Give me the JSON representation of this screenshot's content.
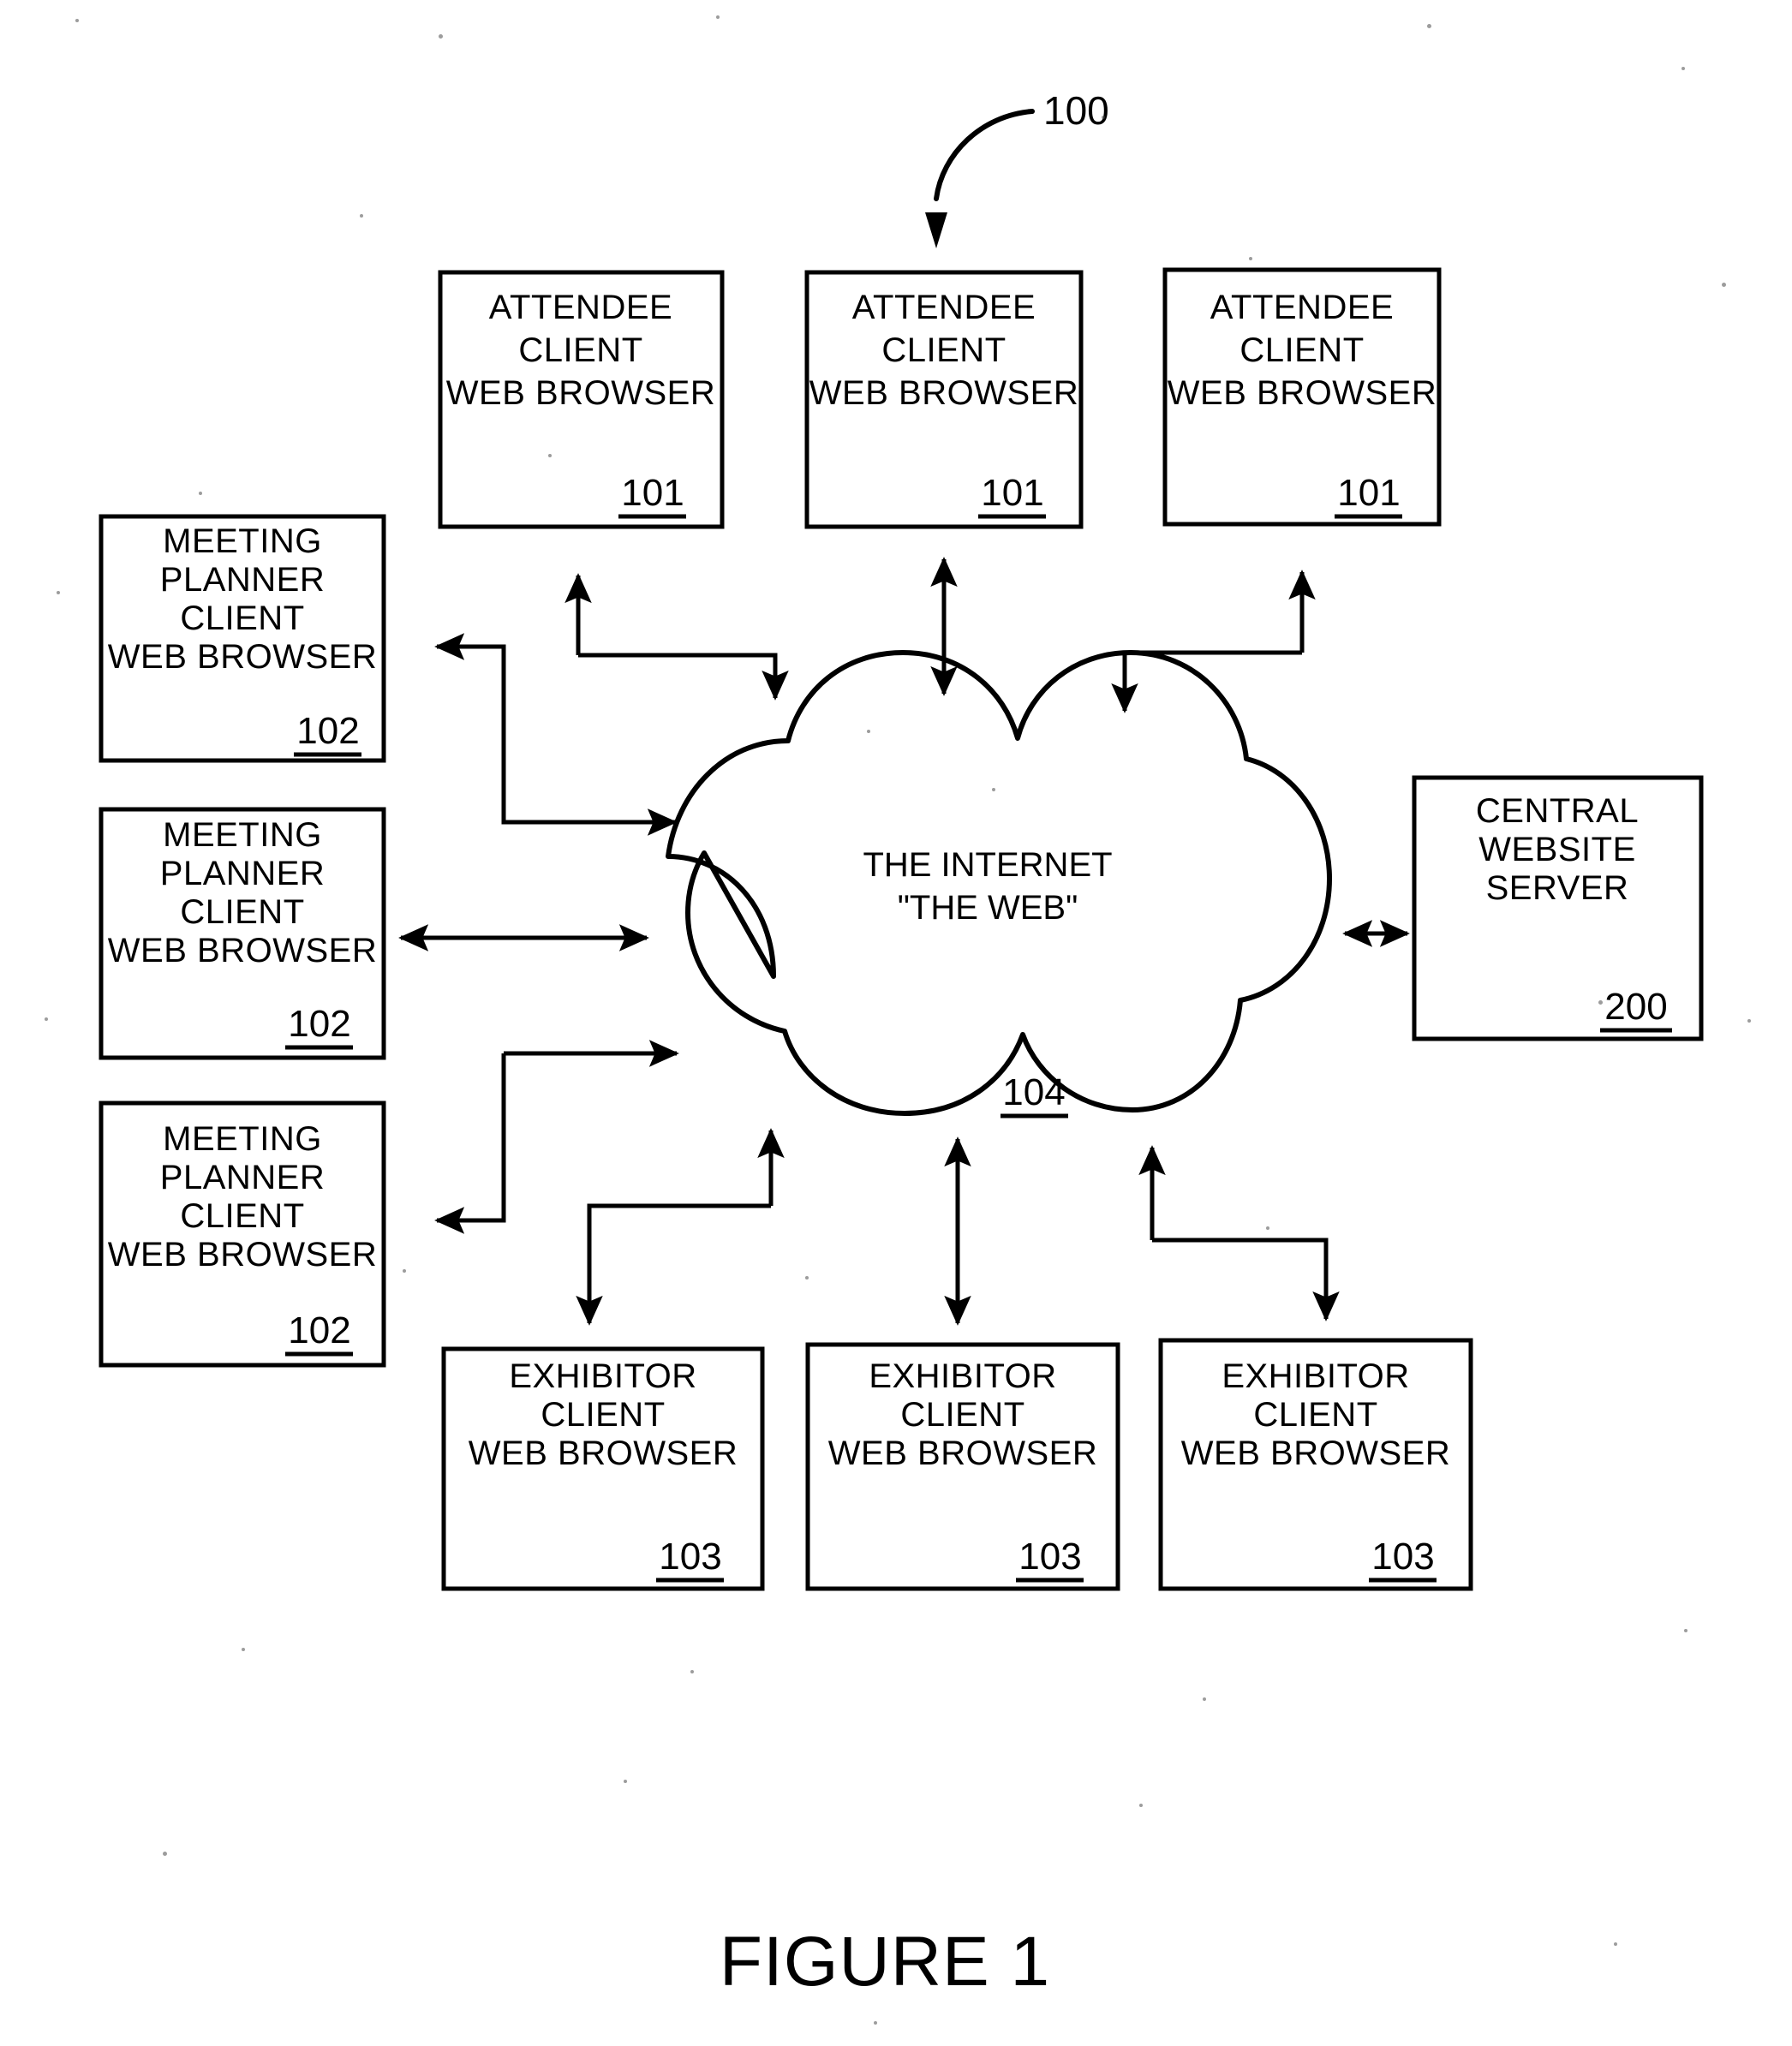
{
  "figure": {
    "caption": "FIGURE 1",
    "system_callout": "100"
  },
  "cloud": {
    "line1": "THE INTERNET",
    "line2": "\"THE WEB\"",
    "ref": "104"
  },
  "attendee_clients": [
    {
      "line1": "ATTENDEE",
      "line2": "CLIENT",
      "line3": "WEB BROWSER",
      "ref": "101"
    },
    {
      "line1": "ATTENDEE",
      "line2": "CLIENT",
      "line3": "WEB BROWSER",
      "ref": "101"
    },
    {
      "line1": "ATTENDEE",
      "line2": "CLIENT",
      "line3": "WEB BROWSER",
      "ref": "101"
    }
  ],
  "meeting_planner_clients": [
    {
      "line1": "MEETING",
      "line2": "PLANNER",
      "line3": "CLIENT",
      "line4": "WEB BROWSER",
      "ref": "102"
    },
    {
      "line1": "MEETING",
      "line2": "PLANNER",
      "line3": "CLIENT",
      "line4": "WEB BROWSER",
      "ref": "102"
    },
    {
      "line1": "MEETING",
      "line2": "PLANNER",
      "line3": "CLIENT",
      "line4": "WEB BROWSER",
      "ref": "102"
    }
  ],
  "exhibitor_clients": [
    {
      "line1": "EXHIBITOR",
      "line2": "CLIENT",
      "line3": "WEB BROWSER",
      "ref": "103"
    },
    {
      "line1": "EXHIBITOR",
      "line2": "CLIENT",
      "line3": "WEB BROWSER",
      "ref": "103"
    },
    {
      "line1": "EXHIBITOR",
      "line2": "CLIENT",
      "line3": "WEB BROWSER",
      "ref": "103"
    }
  ],
  "central_server": {
    "line1": "CENTRAL",
    "line2": "WEBSITE",
    "line3": "SERVER",
    "ref": "200"
  },
  "colors": {
    "ink": "#000000",
    "paper": "#ffffff"
  }
}
